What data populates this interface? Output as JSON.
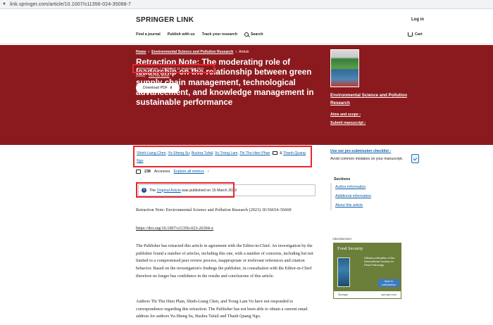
{
  "browser": {
    "url": "link.springer.com/article/10.1007/s11356-024-35088-7"
  },
  "header": {
    "logo": "SPRINGER LINK",
    "login": "Log in",
    "nav": {
      "find_journal": "Find a journal",
      "publish": "Publish with us",
      "track": "Track your research",
      "search": "Search",
      "cart": "Cart"
    }
  },
  "hero": {
    "breadcrumb": {
      "home": "Home",
      "section": "Environmental Science and Pollution Research",
      "current": "Article"
    },
    "title": "Retraction Note: The moderating role of leadership on the relationship between green supply chain management, technological advancement, and knowledge management in sustainable performance",
    "type": "Retraction Note",
    "published": "Published: 21 September 2024",
    "volume": "(2024)",
    "cite": "Cite this article",
    "download": "Download PDF",
    "journal": {
      "name": "Environmental Science and Pollution Research",
      "aims": "Aims and scope",
      "submit": "Submit manuscript"
    }
  },
  "authors": {
    "list": [
      "Shieh-Liang Chen",
      "Yu-Sheng Su",
      "Bushra Tufail",
      "Vu Trong Lam",
      "Thi Thu Hien Phan"
    ],
    "separator": ",",
    "amp": "&",
    "last": "Thanh Quang Ngo"
  },
  "metrics": {
    "accesses_count": "238",
    "accesses_label": "Accesses",
    "explore": "Explore all metrics"
  },
  "notice": {
    "prefix": "The",
    "link": "Original Article",
    "suffix": "was published on 15 March 2023"
  },
  "content": {
    "retraction_head": "Retraction Note: Environmental Science and Pollution Research (2023) 30:56654–56669",
    "doi": "https://doi.org/10.1007/s11356-023-26304-x",
    "para1": "The Publisher has retracted this article in agreement with the Editor-in-Chief. An investigation by the publisher found a number of articles, including this one, with a number of concerns, including but not limited to a compromised peer review process, inappropriate or irrelevant references and citation behavior. Based on the investigation's findings the publisher, in consultation with the Editor-in-Chief therefore no longer has confidence in the results and conclusions of this article.",
    "para2": "Authors Thi Thu Hien Phan, Shieh-Liang Chen, and Trong Lam Vu have not responded to correspondence regarding this retraction. The Publisher has not been able to obtain a current email address for authors Yu-Sheng Su, Bushra Tufail and Thanh Quang Ngo."
  },
  "sidebar": {
    "checklist_link": "Use our pre-submission checklist",
    "checklist_sub": "Avoid common mistakes on your manuscript.",
    "sections_title": "Sections",
    "sections": [
      "Author information",
      "Additional information",
      "About this article"
    ],
    "advertisement": "Advertisement",
    "ad": {
      "title": "Food Security",
      "text": "Official publication of the International Society for Plant Pathology",
      "button": "Open to submissions",
      "brand": "Springer",
      "site": "springer.com"
    }
  }
}
